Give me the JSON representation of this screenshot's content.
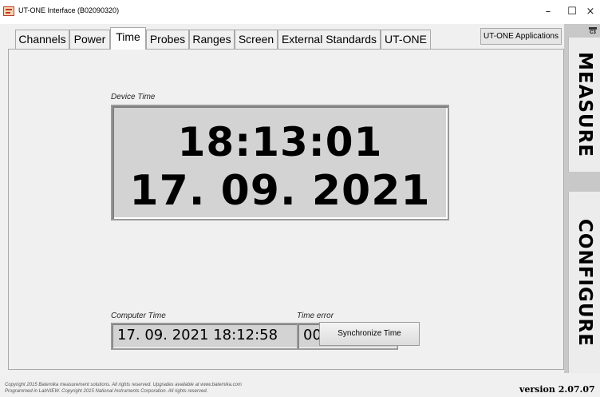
{
  "window": {
    "title": "UT-ONE Interface (B02090320)",
    "minimize": "–",
    "maximize": "☐",
    "close": "×"
  },
  "tabs": [
    {
      "label": "Channels"
    },
    {
      "label": "Power"
    },
    {
      "label": "Time",
      "active": true
    },
    {
      "label": "Probes"
    },
    {
      "label": "Ranges"
    },
    {
      "label": "Screen"
    },
    {
      "label": "External Standards"
    },
    {
      "label": "UT-ONE"
    }
  ],
  "apps_button": "UT-ONE Applications",
  "time_page": {
    "device_time_label": "Device Time",
    "device_time": "18:13:01",
    "device_date": "17. 09. 2021",
    "computer_time_label": "Computer Time",
    "computer_time": "17. 09. 2021 18:12:58",
    "time_error_label": "Time error",
    "time_error": "00:00:02",
    "sync_button": "Synchronize Time"
  },
  "side": {
    "c3_icon_text": "C3",
    "measure": "MEASURE",
    "configure": "CONFIGURE"
  },
  "footer": {
    "line1": "Copyright 2015 Batemika measurement solutions. All rights reserved. Upgrades available at www.batemika.com",
    "line2": "Programmed in LabVIEW. Copyright 2015 National Instruments Corporation. All rights reserved."
  },
  "version": "version 2.07.07",
  "colors": {
    "background": "#f0f0f0",
    "display_bg": "#d3d3d3",
    "border": "#a8a8a8"
  }
}
